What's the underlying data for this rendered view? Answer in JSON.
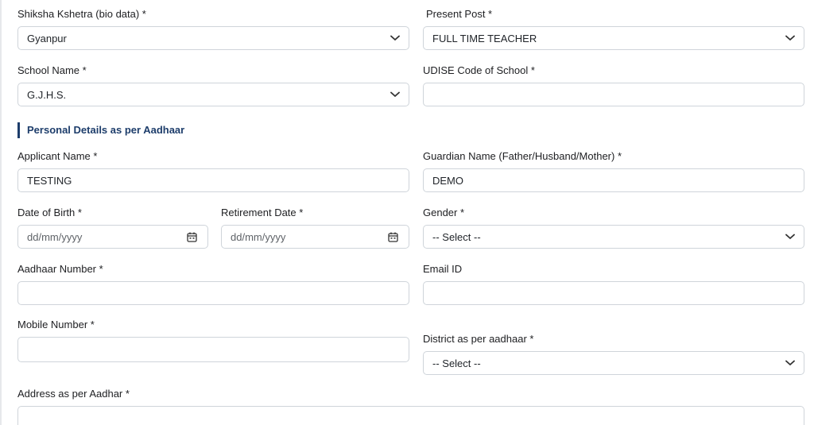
{
  "form": {
    "shiksha_kshetra": {
      "label": "Shiksha Kshetra (bio data) *",
      "value": "Gyanpur"
    },
    "present_post": {
      "label": "Present Post *",
      "value": "FULL TIME TEACHER"
    },
    "school_name": {
      "label": "School Name *",
      "value": "G.J.H.S."
    },
    "udise_code": {
      "label": "UDISE Code of School *",
      "value": ""
    },
    "section_title": "Personal Details as per Aadhaar",
    "applicant_name": {
      "label": "Applicant Name *",
      "value": "TESTING"
    },
    "guardian_name": {
      "label": "Guardian Name (Father/Husband/Mother) *",
      "value": "DEMO"
    },
    "date_of_birth": {
      "label": "Date of Birth *",
      "placeholder": "dd/mm/yyyy"
    },
    "retirement_date": {
      "label": "Retirement Date *",
      "placeholder": "dd/mm/yyyy"
    },
    "gender": {
      "label": "Gender *",
      "value": "-- Select --"
    },
    "aadhaar_number": {
      "label": "Aadhaar Number *",
      "value": ""
    },
    "email_id": {
      "label": "Email ID",
      "value": ""
    },
    "mobile_number": {
      "label": "Mobile Number *",
      "value": ""
    },
    "district": {
      "label": "District as per aadhaar *",
      "value": "-- Select --"
    },
    "address": {
      "label": "Address as per Aadhar *",
      "value": ""
    }
  },
  "icons": {
    "dropdown": "chevron-down-icon",
    "date": "calendar-icon"
  },
  "colors": {
    "accent": "#1d3d6b",
    "border": "#cfd4da",
    "text": "#202124"
  }
}
